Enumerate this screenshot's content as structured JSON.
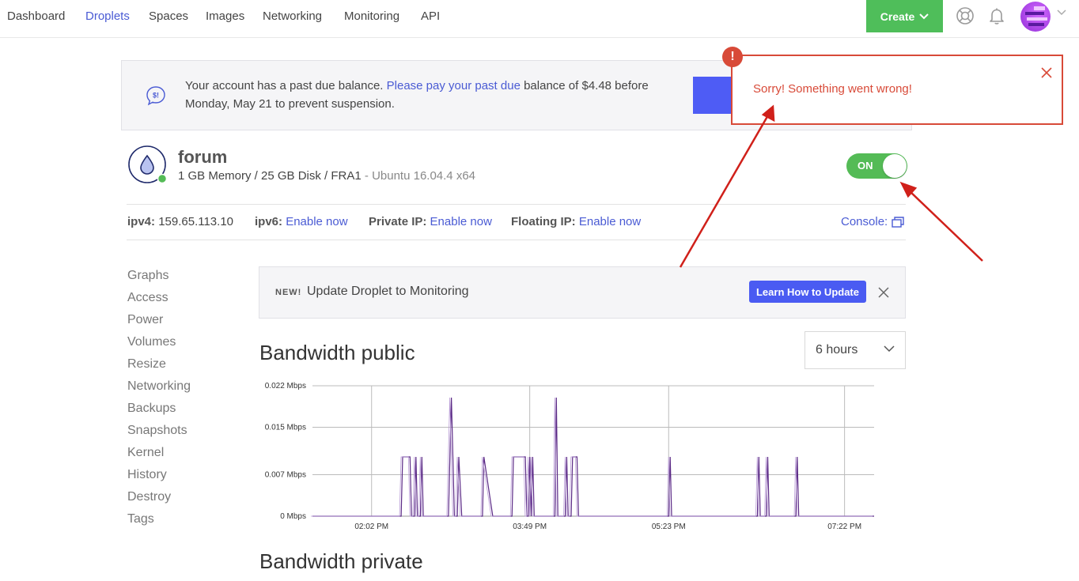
{
  "nav": {
    "links": [
      "Dashboard",
      "Droplets",
      "Spaces",
      "Images",
      "Networking",
      "Monitoring",
      "API"
    ],
    "active": "Droplets",
    "create_label": "Create",
    "icons": [
      "support-icon",
      "bell-icon",
      "avatar",
      "chevron-down-icon"
    ]
  },
  "due_banner": {
    "text_before": "Your account has a past due balance. ",
    "link": "Please pay your past due",
    "text_after": " balance of $4.48 before Monday, May 21 to prevent suspension."
  },
  "toast": {
    "badge": "!",
    "message": "Sorry! Something went wrong!"
  },
  "droplet": {
    "name": "forum",
    "specs": "1 GB Memory / 25 GB Disk / FRA1",
    "os": " - Ubuntu 16.04.4 x64",
    "power_label": "ON",
    "power_on": true
  },
  "ip": {
    "ipv4_label": "ipv4:",
    "ipv4_value": "159.65.113.10",
    "ipv6_label": "ipv6:",
    "ipv6_value": "Enable now",
    "private_label": "Private IP:",
    "private_value": "Enable now",
    "floating_label": "Floating IP:",
    "floating_value": "Enable now",
    "console_label": "Console:"
  },
  "sidebar": {
    "items": [
      "Graphs",
      "Access",
      "Power",
      "Volumes",
      "Resize",
      "Networking",
      "Backups",
      "Snapshots",
      "Kernel",
      "History",
      "Destroy",
      "Tags"
    ]
  },
  "monitoring_banner": {
    "badge": "NEW!",
    "text": "Update Droplet to Monitoring",
    "button": "Learn How to Update"
  },
  "bandwidth_public": {
    "title": "Bandwidth public",
    "range": "6 hours"
  },
  "bandwidth_private": {
    "title": "Bandwidth private"
  },
  "colors": {
    "accent": "#4a5bd4",
    "green": "#54bb56",
    "error": "#d84a38",
    "series": "#5b2a86"
  },
  "chart_data": {
    "type": "line",
    "title": "Bandwidth public",
    "y_tick_labels": [
      "0 Mbps",
      "0.007 Mbps",
      "0.015 Mbps",
      "0.022 Mbps"
    ],
    "y_ticks": [
      0,
      0.007,
      0.015,
      0.022
    ],
    "ylim": [
      0,
      0.022
    ],
    "x_tick_labels": [
      "02:02 PM",
      "03:49 PM",
      "05:23 PM",
      "07:22 PM"
    ],
    "x_ticks": [
      0,
      107,
      201,
      320
    ],
    "xlim": [
      -40,
      340
    ],
    "x_unit": "minutes since 02:02 PM",
    "grid": true,
    "series": [
      {
        "name": "",
        "values": [
          [
            -40,
            0
          ],
          [
            20,
            0
          ],
          [
            21,
            0.01
          ],
          [
            26,
            0.01
          ],
          [
            27,
            0
          ],
          [
            29,
            0
          ],
          [
            30,
            0.01
          ],
          [
            31,
            0
          ],
          [
            33,
            0
          ],
          [
            34,
            0.01
          ],
          [
            35,
            0
          ],
          [
            52,
            0
          ],
          [
            54,
            0.02
          ],
          [
            56,
            0
          ],
          [
            58,
            0
          ],
          [
            59,
            0.01
          ],
          [
            61,
            0
          ],
          [
            75,
            0
          ],
          [
            76,
            0.01
          ],
          [
            82,
            0
          ],
          [
            95,
            0
          ],
          [
            96,
            0.01
          ],
          [
            104,
            0.01
          ],
          [
            105,
            0
          ],
          [
            106,
            0
          ],
          [
            107,
            0.01
          ],
          [
            108,
            0
          ],
          [
            109,
            0.01
          ],
          [
            110,
            0
          ],
          [
            124,
            0
          ],
          [
            125,
            0.02
          ],
          [
            126,
            0
          ],
          [
            131,
            0
          ],
          [
            132,
            0.01
          ],
          [
            133,
            0
          ],
          [
            135,
            0
          ],
          [
            136,
            0.01
          ],
          [
            139,
            0.01
          ],
          [
            140,
            0
          ],
          [
            201,
            0
          ],
          [
            202,
            0.01
          ],
          [
            203,
            0
          ],
          [
            261,
            0
          ],
          [
            262,
            0.01
          ],
          [
            263,
            0
          ],
          [
            267,
            0
          ],
          [
            268,
            0.01
          ],
          [
            269,
            0
          ],
          [
            287,
            0
          ],
          [
            288,
            0.01
          ],
          [
            289,
            0
          ],
          [
            340,
            0
          ]
        ]
      }
    ]
  }
}
